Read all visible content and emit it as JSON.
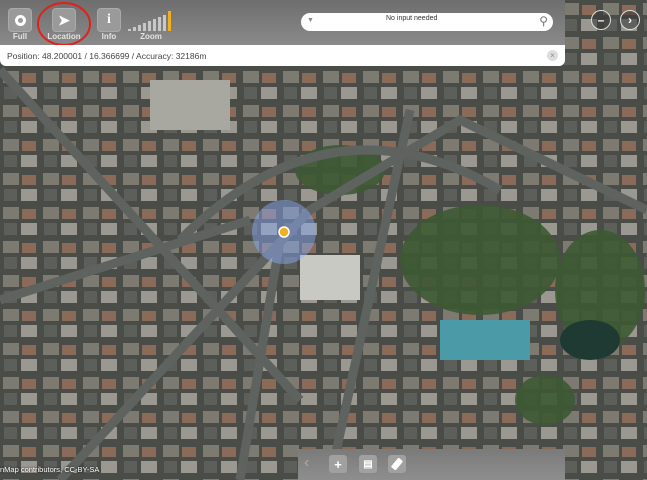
{
  "toolbar": {
    "buttons": [
      {
        "label": "Full",
        "icon": "circle-icon"
      },
      {
        "label": "Location",
        "icon": "location-arrow-icon"
      },
      {
        "label": "Info",
        "icon": "info-icon"
      }
    ],
    "zoom_label": "Zoom",
    "zoom_levels": 9,
    "zoom_active": 9
  },
  "search": {
    "placeholder": "No input needed"
  },
  "position": {
    "text": "Position: 48.200001 / 16.366699 / Accuracy: 32186m"
  },
  "nav": {
    "minus": "–",
    "next": "›"
  },
  "bottom": {
    "back": "‹",
    "add": "+"
  },
  "attribution": "nMap contributors, CC-BY-SA",
  "colors": {
    "accent": "#f0b020",
    "highlight_circle": "#e0201a"
  }
}
